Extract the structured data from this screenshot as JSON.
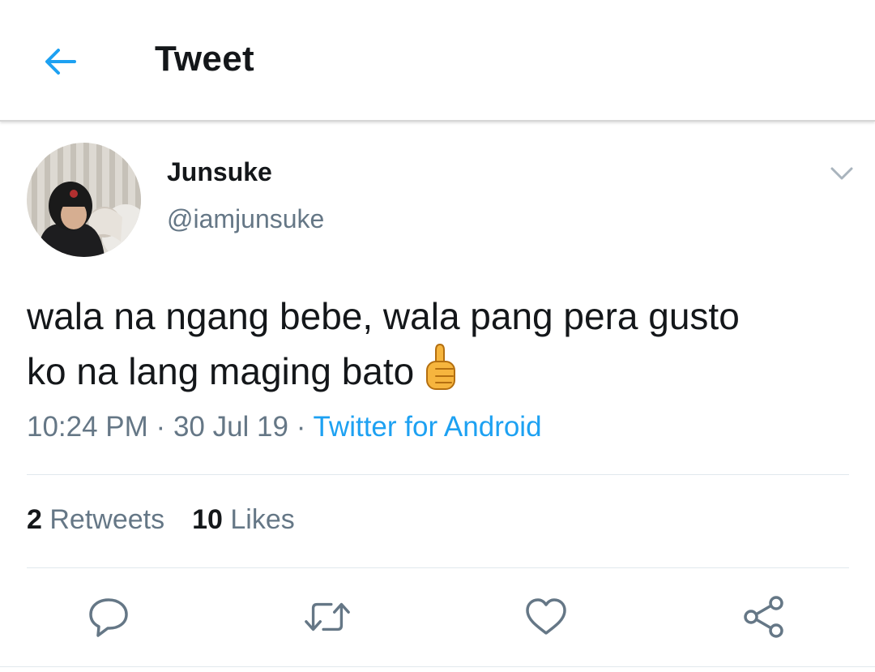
{
  "colors": {
    "accent": "#1da1f2",
    "text_primary": "#14171a",
    "text_secondary": "#657786",
    "icon_gray": "#657786",
    "divider": "#e1e8ed"
  },
  "header": {
    "back_icon": "arrow-left-icon",
    "title": "Tweet"
  },
  "tweet": {
    "author": {
      "display_name": "Junsuke",
      "handle": "@iamjunsuke"
    },
    "menu_icon": "chevron-down-icon",
    "text_line1": "wala na ngang bebe, wala pang pera gusto",
    "text_line2": "ko na lang maging bato",
    "emoji": "thumbs-up-emoji",
    "time": "10:24 PM",
    "date": "30 Jul 19",
    "separator": "·",
    "source": "Twitter for Android"
  },
  "stats": {
    "retweets_count": "2",
    "retweets_label": "Retweets",
    "likes_count": "10",
    "likes_label": "Likes"
  },
  "actions": {
    "reply_icon": "reply-icon",
    "retweet_icon": "retweet-icon",
    "like_icon": "heart-icon",
    "share_icon": "share-icon"
  }
}
